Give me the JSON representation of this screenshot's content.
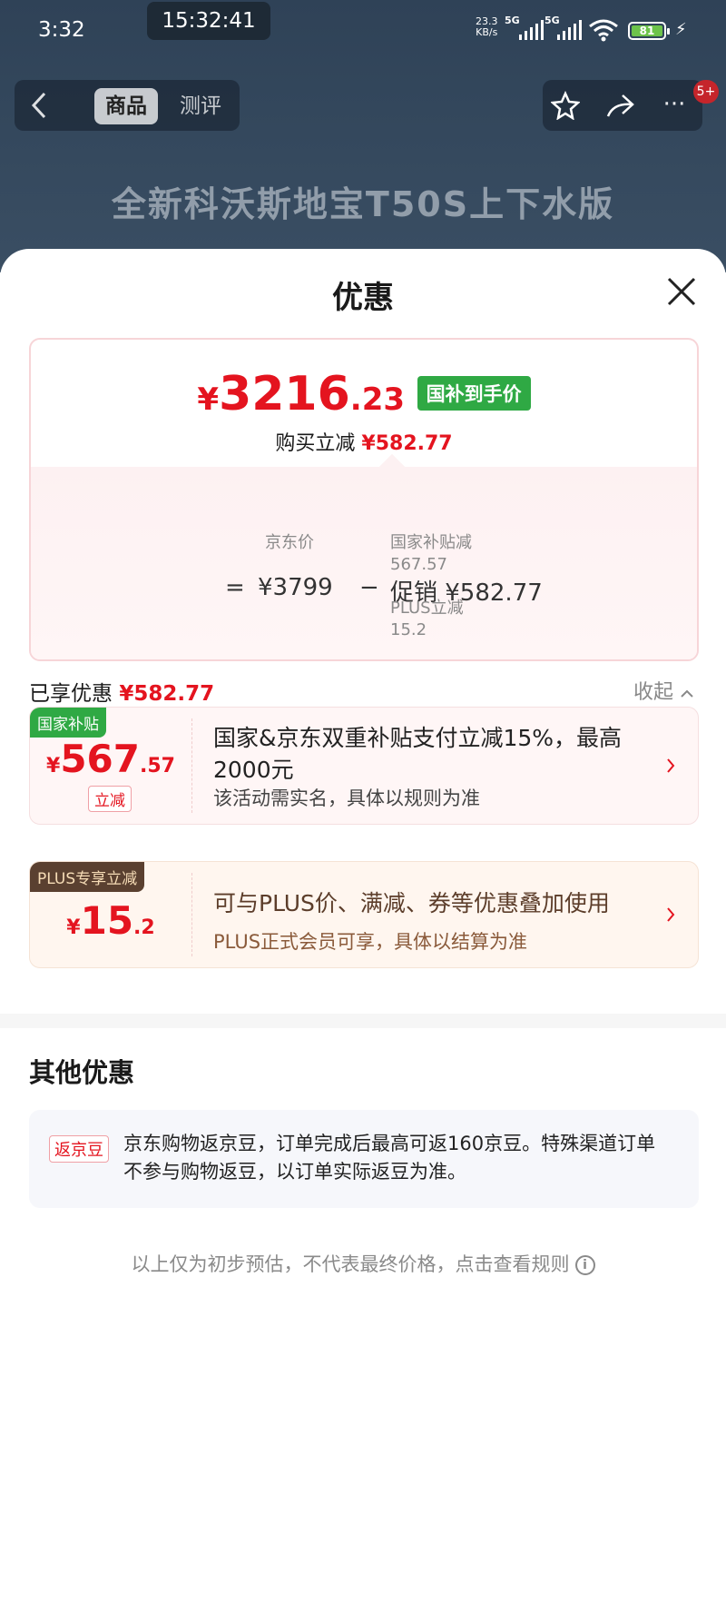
{
  "status_bar": {
    "time": "3:32",
    "recording_time": "15:32:41",
    "net_speed_value": "23.3",
    "net_speed_unit": "KB/s",
    "network_1": "5G",
    "network_2": "5G",
    "battery": "81"
  },
  "background_page": {
    "tabs": [
      "商品",
      "测评"
    ],
    "active_tab": "商品",
    "notification_badge": "5+",
    "banner_title": "全新科沃斯地宝T50S上下水版",
    "icons": [
      "back-icon",
      "star-icon",
      "share-icon",
      "more-icon"
    ]
  },
  "sheet": {
    "title": "优惠",
    "summary": {
      "final_price_symbol": "¥",
      "final_price_int": "3216",
      "final_price_dec": ".23",
      "final_price_tag": "国补到手价",
      "save_label": "购买立减",
      "save_amount": "¥582.77",
      "equals": "=",
      "jd_price": "¥3799",
      "jd_price_label": "京东价",
      "minus": "−",
      "promo": "促销 ¥582.77",
      "promo_items": [
        {
          "label": "国家补贴减",
          "value": "567.57"
        },
        {
          "label": "PLUS立减",
          "value": "15.2"
        }
      ]
    },
    "enjoyed_label": "已享优惠",
    "enjoyed_amount": "¥582.77",
    "collapse_label": "收起",
    "discounts": [
      {
        "tag": "国家补贴",
        "symbol": "¥",
        "amount_int": "567",
        "amount_dec": ".57",
        "badge": "立减",
        "title": "国家&京东双重补贴支付立减15%，最高2000元",
        "subtitle": "该活动需实名，具体以规则为准"
      },
      {
        "tag": "PLUS专享立减",
        "symbol": "¥",
        "amount_int": "15",
        "amount_dec": ".2",
        "title": "可与PLUS价、满减、券等优惠叠加使用",
        "subtitle": "PLUS正式会员可享，具体以结算为准"
      }
    ],
    "other_title": "其他优惠",
    "other_tag": "返京豆",
    "other_text": "京东购物返京豆，订单完成后最高可返160京豆。特殊渠道订单不参与购物返豆，以订单实际返豆为准。",
    "disclaimer": "以上仅为初步预估，不代表最终价格，点击查看规则",
    "info_glyph": "i"
  },
  "colors": {
    "accent_red": "#e4141f",
    "subsidy_green": "#2fa944",
    "plus_brown": "#5a4030"
  }
}
